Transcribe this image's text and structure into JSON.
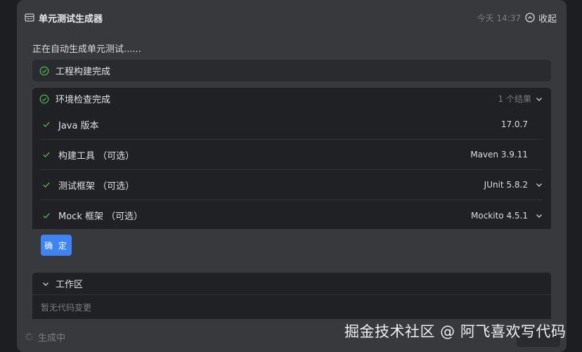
{
  "header": {
    "title": "单元测试生成器",
    "time": "今天 14:37",
    "collapse_label": "收起"
  },
  "status_line": "正在自动生成单元测试......",
  "step_build": {
    "label": "工程构建完成"
  },
  "env_check": {
    "label": "环境检查完成",
    "count": "1 个结果",
    "rows": [
      {
        "name": "Java 版本",
        "value": "17.0.7"
      },
      {
        "name": "构建工具  （可选）",
        "value": "Maven 3.9.11"
      },
      {
        "name": "测试框架  （可选）",
        "value": "JUnit 5.8.2"
      },
      {
        "name": "Mock 框架  （可选）",
        "value": "Mockito 4.5.1"
      }
    ]
  },
  "confirm_label": "确 定",
  "workspace": {
    "label": "工作区",
    "empty_text": "暂无代码变更"
  },
  "footer": {
    "status_label": "生成中"
  },
  "watermark": "掘金技术社区 @ 阿飞喜欢写代码",
  "colors": {
    "accent": "#3f84f5",
    "success": "#4caf50",
    "card_bg": "#38393d",
    "panel_bg": "#202124"
  }
}
